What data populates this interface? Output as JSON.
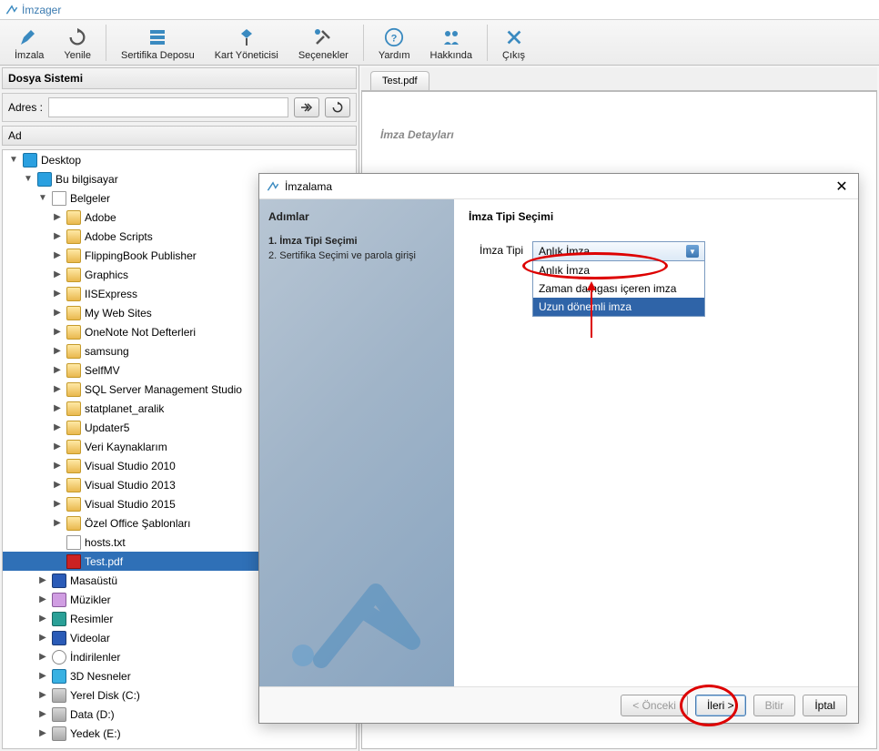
{
  "app": {
    "title": "İmzager"
  },
  "toolbar": {
    "sign": "İmzala",
    "refresh": "Yenile",
    "certstore": "Sertifika Deposu",
    "cardmgr": "Kart Yöneticisi",
    "options": "Seçenekler",
    "help": "Yardım",
    "about": "Hakkında",
    "exit": "Çıkış"
  },
  "left": {
    "panelTitle": "Dosya Sistemi",
    "addressLabel": "Adres :",
    "addressValue": "",
    "columnHeader": "Ad",
    "tree": [
      {
        "depth": 0,
        "arrow": "▼",
        "icon": "monitor",
        "label": "Desktop"
      },
      {
        "depth": 1,
        "arrow": "▼",
        "icon": "monitor",
        "label": "Bu bilgisayar"
      },
      {
        "depth": 2,
        "arrow": "▼",
        "icon": "doc",
        "label": "Belgeler"
      },
      {
        "depth": 3,
        "arrow": "▶",
        "icon": "folder",
        "label": "Adobe"
      },
      {
        "depth": 3,
        "arrow": "▶",
        "icon": "folder",
        "label": "Adobe Scripts"
      },
      {
        "depth": 3,
        "arrow": "▶",
        "icon": "folder",
        "label": "FlippingBook Publisher"
      },
      {
        "depth": 3,
        "arrow": "▶",
        "icon": "folder",
        "label": "Graphics"
      },
      {
        "depth": 3,
        "arrow": "▶",
        "icon": "folder",
        "label": "IISExpress"
      },
      {
        "depth": 3,
        "arrow": "▶",
        "icon": "folder",
        "label": "My Web Sites"
      },
      {
        "depth": 3,
        "arrow": "▶",
        "icon": "folder",
        "label": "OneNote Not Defterleri"
      },
      {
        "depth": 3,
        "arrow": "▶",
        "icon": "folder",
        "label": "samsung"
      },
      {
        "depth": 3,
        "arrow": "▶",
        "icon": "folder",
        "label": "SelfMV"
      },
      {
        "depth": 3,
        "arrow": "▶",
        "icon": "folder",
        "label": "SQL Server Management Studio"
      },
      {
        "depth": 3,
        "arrow": "▶",
        "icon": "folder",
        "label": "statplanet_aralik"
      },
      {
        "depth": 3,
        "arrow": "▶",
        "icon": "folder",
        "label": "Updater5"
      },
      {
        "depth": 3,
        "arrow": "▶",
        "icon": "folder",
        "label": "Veri Kaynaklarım"
      },
      {
        "depth": 3,
        "arrow": "▶",
        "icon": "folder",
        "label": "Visual Studio 2010"
      },
      {
        "depth": 3,
        "arrow": "▶",
        "icon": "folder",
        "label": "Visual Studio 2013"
      },
      {
        "depth": 3,
        "arrow": "▶",
        "icon": "folder",
        "label": "Visual Studio 2015"
      },
      {
        "depth": 3,
        "arrow": "▶",
        "icon": "folder",
        "label": "Özel Office Şablonları"
      },
      {
        "depth": 3,
        "arrow": "",
        "icon": "doc",
        "label": "hosts.txt"
      },
      {
        "depth": 3,
        "arrow": "",
        "icon": "pdf",
        "label": "Test.pdf",
        "selected": true
      },
      {
        "depth": 2,
        "arrow": "▶",
        "icon": "media",
        "label": "Masaüstü"
      },
      {
        "depth": 2,
        "arrow": "▶",
        "icon": "note",
        "label": "Müzikler"
      },
      {
        "depth": 2,
        "arrow": "▶",
        "icon": "pic",
        "label": "Resimler"
      },
      {
        "depth": 2,
        "arrow": "▶",
        "icon": "media",
        "label": "Videolar"
      },
      {
        "depth": 2,
        "arrow": "▶",
        "icon": "dl",
        "label": "İndirilenler"
      },
      {
        "depth": 2,
        "arrow": "▶",
        "icon": "cube",
        "label": "3D Nesneler"
      },
      {
        "depth": 2,
        "arrow": "▶",
        "icon": "drive",
        "label": "Yerel Disk (C:)"
      },
      {
        "depth": 2,
        "arrow": "▶",
        "icon": "drive",
        "label": "Data (D:)"
      },
      {
        "depth": 2,
        "arrow": "▶",
        "icon": "drive",
        "label": "Yedek (E:)"
      }
    ]
  },
  "right": {
    "tab": "Test.pdf",
    "detailLabel": "İmza Detayları"
  },
  "dialog": {
    "title": "İmzalama",
    "stepsHeader": "Adımlar",
    "steps": [
      "1. İmza Tipi Seçimi",
      "2. Sertifika Seçimi ve parola girişi"
    ],
    "activeStep": 0,
    "mainHeader": "İmza Tipi Seçimi",
    "comboLabel": "İmza Tipi",
    "comboSelected": "Anlık İmza",
    "comboOptions": [
      "Anlık İmza",
      "Zaman damgası içeren imza",
      "Uzun dönemli imza"
    ],
    "hoverOption": 2,
    "buttons": {
      "back": "< Önceki",
      "next": "İleri >",
      "finish": "Bitir",
      "cancel": "İptal"
    }
  }
}
